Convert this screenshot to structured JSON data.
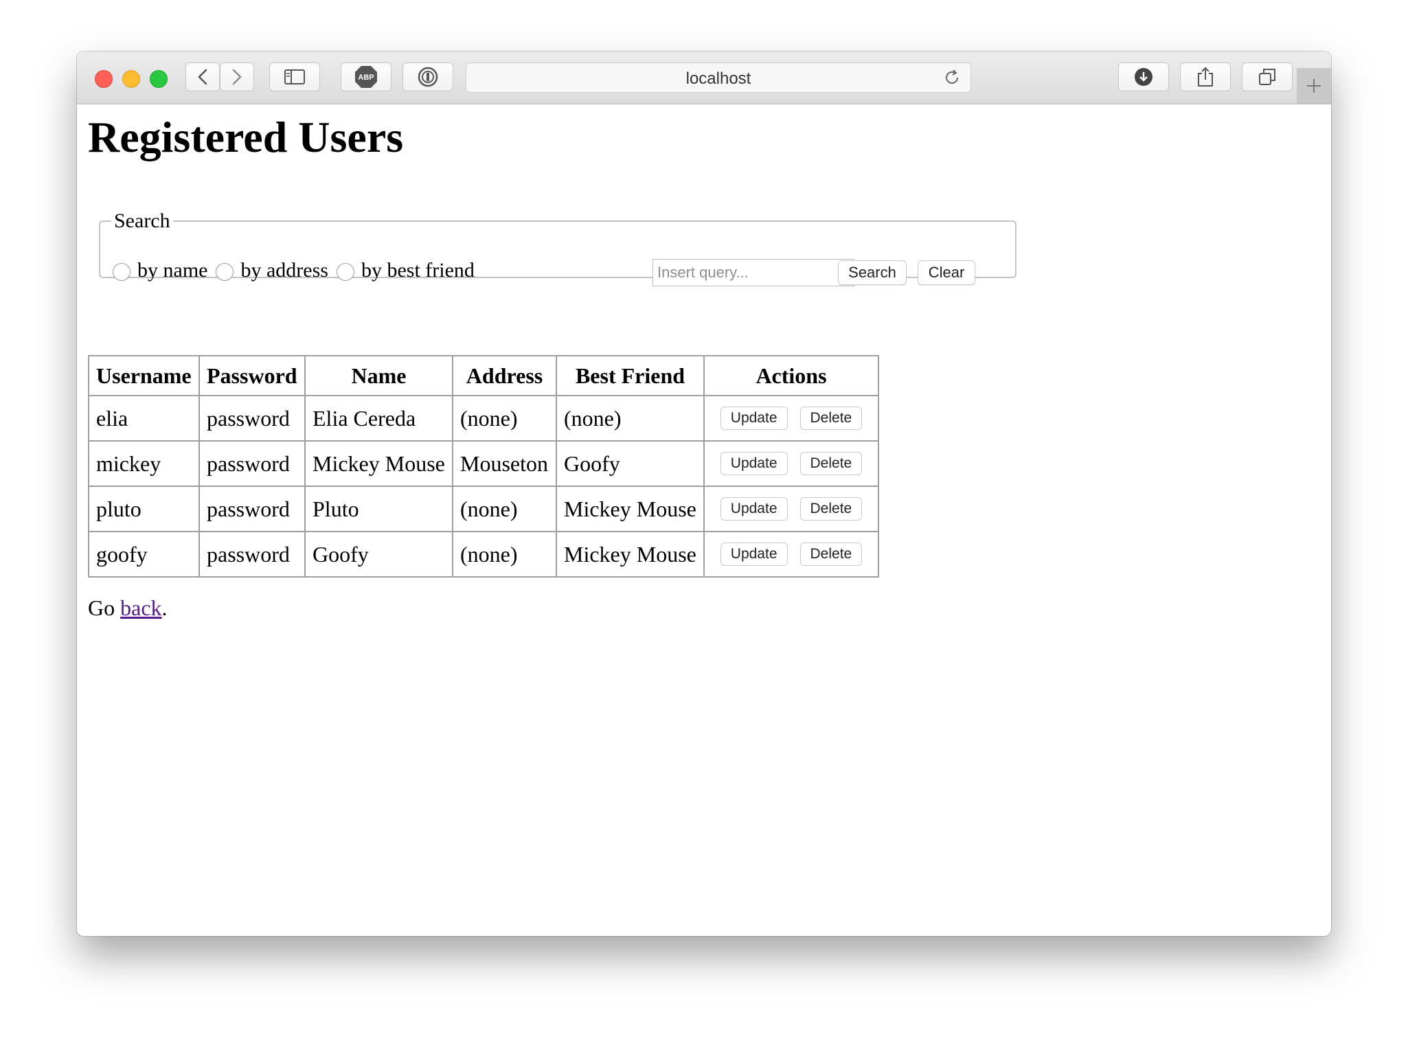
{
  "browser": {
    "url": "localhost",
    "icons": {
      "back": "chevron-left-icon",
      "forward": "chevron-right-icon",
      "sidebar": "sidebar-icon",
      "adblock": "abp-icon",
      "password": "1password-icon",
      "reload": "reload-icon",
      "download": "download-icon",
      "share": "share-icon",
      "tabs": "tabs-icon",
      "new_tab": "plus-icon"
    },
    "adblock_label": "ABP"
  },
  "page": {
    "title": "Registered Users"
  },
  "search": {
    "legend": "Search",
    "options": [
      "by name",
      "by address",
      "by best friend"
    ],
    "placeholder": "Insert query...",
    "value": "",
    "search_label": "Search",
    "clear_label": "Clear"
  },
  "table": {
    "headers": [
      "Username",
      "Password",
      "Name",
      "Address",
      "Best Friend",
      "Actions"
    ],
    "rows": [
      {
        "username": "elia",
        "password": "password",
        "name": "Elia Cereda",
        "address": "(none)",
        "best_friend": "(none)"
      },
      {
        "username": "mickey",
        "password": "password",
        "name": "Mickey Mouse",
        "address": "Mouseton",
        "best_friend": "Goofy"
      },
      {
        "username": "pluto",
        "password": "password",
        "name": "Pluto",
        "address": "(none)",
        "best_friend": "Mickey Mouse"
      },
      {
        "username": "goofy",
        "password": "password",
        "name": "Goofy",
        "address": "(none)",
        "best_friend": "Mickey Mouse"
      }
    ],
    "update_label": "Update",
    "delete_label": "Delete"
  },
  "footer": {
    "prefix": "Go ",
    "link": "back",
    "suffix": "."
  },
  "colors": {
    "link_visited": "#551a8b",
    "traffic_red": "#fe5f57",
    "traffic_yellow": "#febc2e",
    "traffic_green": "#28c840"
  }
}
